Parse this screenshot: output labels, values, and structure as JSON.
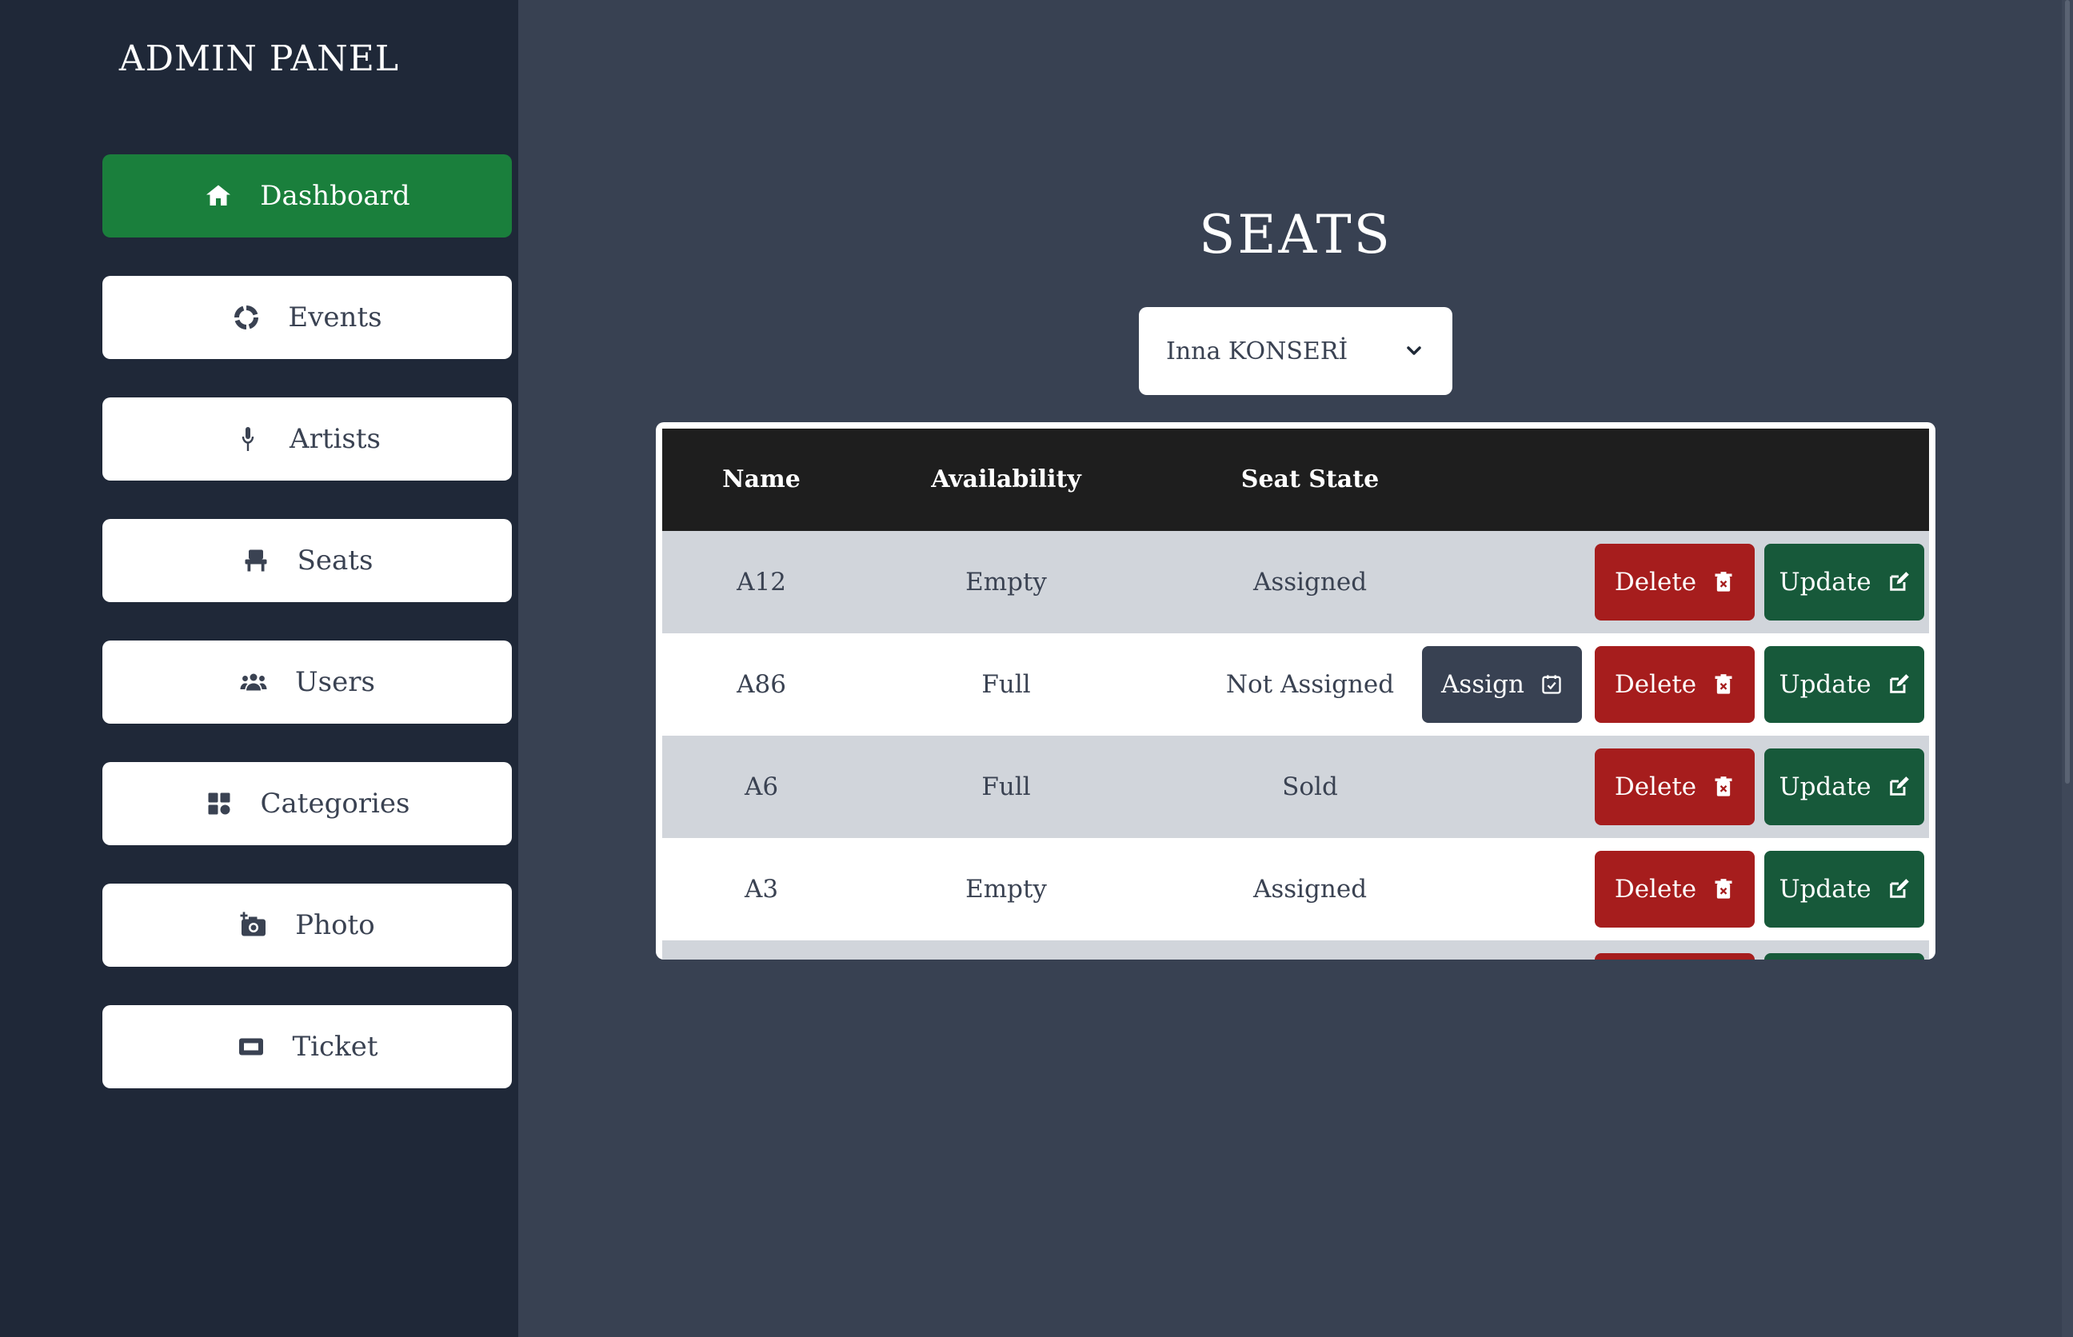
{
  "sidebar": {
    "title": "ADMIN PANEL",
    "items": [
      {
        "label": "Dashboard",
        "icon": "home-icon",
        "active": true
      },
      {
        "label": "Events",
        "icon": "circle-notch-icon",
        "active": false
      },
      {
        "label": "Artists",
        "icon": "microphone-icon",
        "active": false
      },
      {
        "label": "Seats",
        "icon": "chair-icon",
        "active": false
      },
      {
        "label": "Users",
        "icon": "users-icon",
        "active": false
      },
      {
        "label": "Categories",
        "icon": "grid-icon",
        "active": false
      },
      {
        "label": "Photo",
        "icon": "camera-plus-icon",
        "active": false
      },
      {
        "label": "Ticket",
        "icon": "ticket-icon",
        "active": false
      }
    ]
  },
  "main": {
    "title": "SEATS",
    "event_select": {
      "value": "Inna KONSERİ"
    },
    "table": {
      "columns": [
        "Name",
        "Availability",
        "Seat State"
      ],
      "rows": [
        {
          "name": "A12",
          "availability": "Empty",
          "state": "Assigned",
          "assign": false
        },
        {
          "name": "A86",
          "availability": "Full",
          "state": "Not Assigned",
          "assign": true
        },
        {
          "name": "A6",
          "availability": "Full",
          "state": "Sold",
          "assign": false
        },
        {
          "name": "A3",
          "availability": "Empty",
          "state": "Assigned",
          "assign": false
        }
      ],
      "actions": {
        "assign_label": "Assign",
        "delete_label": "Delete",
        "update_label": "Update"
      }
    }
  },
  "colors": {
    "sidebar_bg": "#1f2838",
    "main_bg": "#384152",
    "active_green": "#1a7f3c",
    "delete_red": "#a61d1d",
    "update_green": "#17593a",
    "table_head": "#1e1e1e",
    "row_alt": "#d1d5db"
  }
}
